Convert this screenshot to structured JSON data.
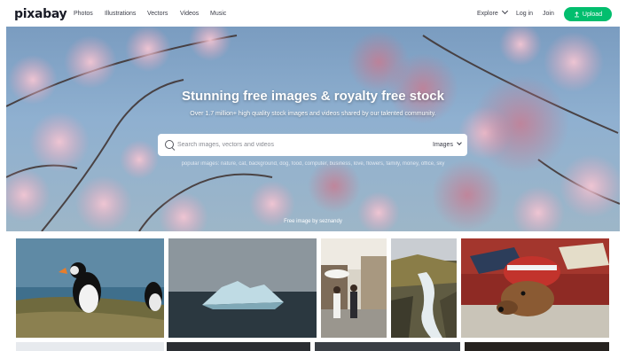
{
  "nav": {
    "logo": "pixabay",
    "links": [
      "Photos",
      "Illustrations",
      "Vectors",
      "Videos",
      "Music"
    ],
    "explore": "Explore",
    "login": "Log in",
    "join": "Join",
    "upload": "Upload"
  },
  "hero": {
    "title": "Stunning free images & royalty free stock",
    "subtitle": "Over 1.7 million+ high quality stock images and videos shared by our talented community.",
    "search_placeholder": "Search images, vectors and videos",
    "search_type": "Images",
    "tags": "popular images: nature, cat, background, dog, food, computer, business, love, flowers, family, money, office, sky",
    "credit": "Free image by seznandy"
  },
  "colors": {
    "accent": "#02be6e",
    "text": "#191b26"
  },
  "icons": [
    "search-icon",
    "chevron-down-icon",
    "upload-icon"
  ]
}
